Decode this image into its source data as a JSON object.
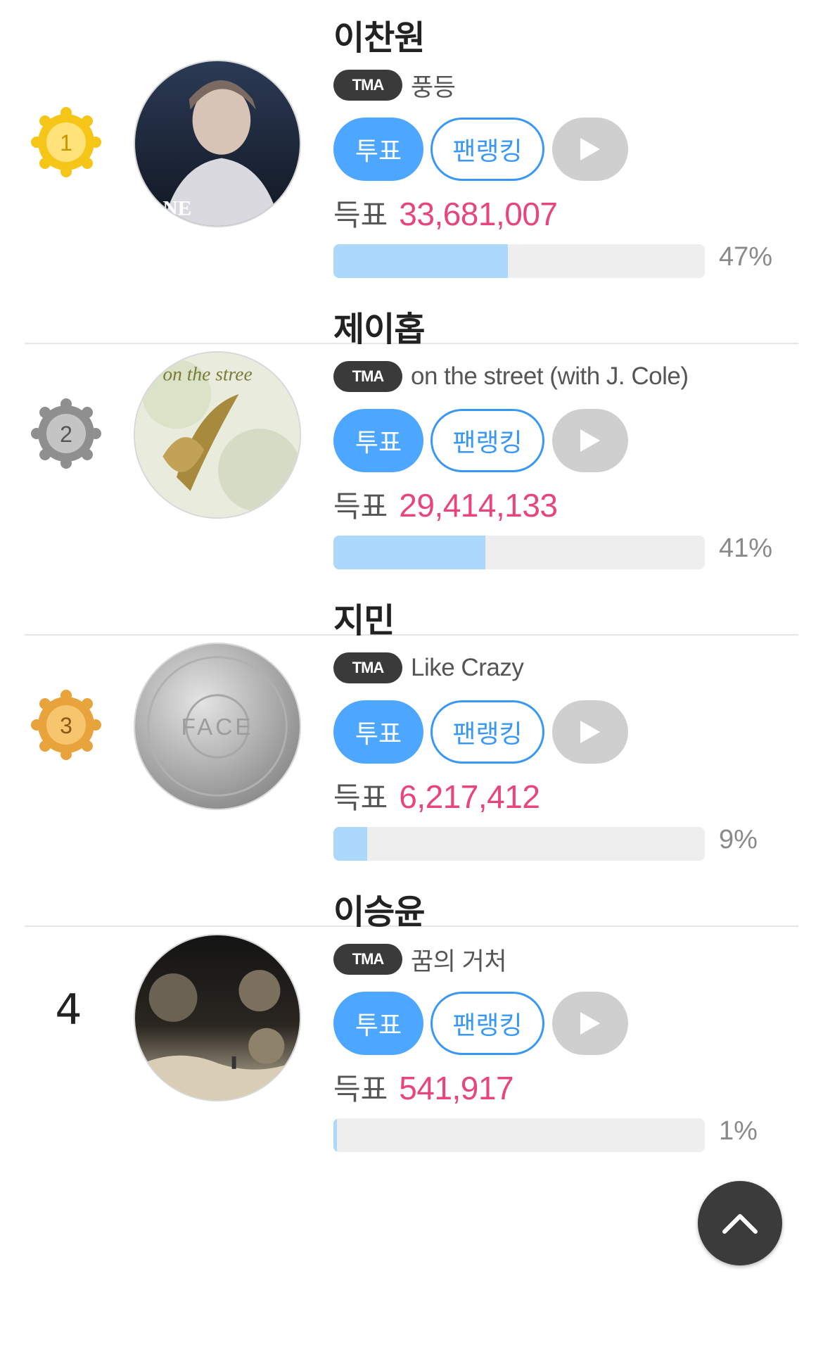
{
  "entries": [
    {
      "rank": "1",
      "rank_icon": "gold-medal-icon",
      "medal_color": "#f5c518",
      "artist": "이찬원",
      "badge": "TMA",
      "song": "풍등",
      "vote_label": "투표",
      "fanranking_label": "팬랭킹",
      "votes_label": "득표",
      "votes": "33,681,007",
      "percent_text": "47%",
      "percent": 47,
      "cover_label": "NE"
    },
    {
      "rank": "2",
      "rank_icon": "silver-medal-icon",
      "medal_color": "#8f8f8f",
      "artist": "제이홉",
      "badge": "TMA",
      "song": "on the street (with J. Cole)",
      "vote_label": "투표",
      "fanranking_label": "팬랭킹",
      "votes_label": "득표",
      "votes": "29,414,133",
      "percent_text": "41%",
      "percent": 41,
      "cover_label": "on the stree"
    },
    {
      "rank": "3",
      "rank_icon": "bronze-medal-icon",
      "medal_color": "#e8a33c",
      "artist": "지민",
      "badge": "TMA",
      "song": "Like Crazy",
      "vote_label": "투표",
      "fanranking_label": "팬랭킹",
      "votes_label": "득표",
      "votes": "6,217,412",
      "percent_text": "9%",
      "percent": 9,
      "cover_label": "FACE"
    },
    {
      "rank": "4",
      "rank_icon": "",
      "artist": "이승윤",
      "badge": "TMA",
      "song": "꿈의 거처",
      "vote_label": "투표",
      "fanranking_label": "팬랭킹",
      "votes_label": "득표",
      "votes": "541,917",
      "percent_text": "1%",
      "percent": 1,
      "cover_label": ""
    }
  ],
  "colors": {
    "accent": "#4da6ff",
    "votes": "#e8457a",
    "bar_fill": "#abd8fb",
    "bar_track": "#eeeeee"
  },
  "scroll_top_icon": "chevron-up-icon"
}
